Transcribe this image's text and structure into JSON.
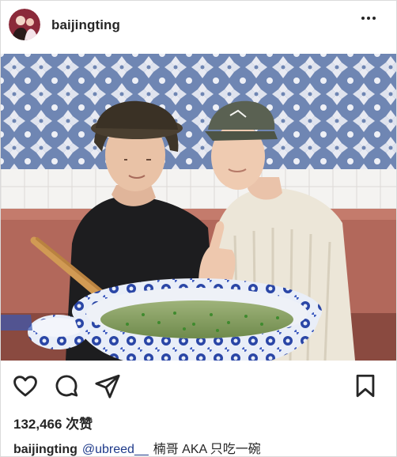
{
  "post": {
    "username": "baijingting",
    "likes": "132,466 次赞",
    "caption": {
      "username": "baijingting",
      "mention": "@ubreed__",
      "text": "楠哥 AKA 只吃一碗"
    }
  },
  "icons": {
    "more": "more-options-icon",
    "like": "heart-icon",
    "comment": "comment-bubble-icon",
    "share": "paper-plane-icon",
    "save": "bookmark-icon"
  },
  "colors": {
    "text": "#262626",
    "mention": "#1e3a8a",
    "tile_blue": "#6f86b3",
    "booth": "#b2685b",
    "bowl_blue": "#2a46a6"
  }
}
